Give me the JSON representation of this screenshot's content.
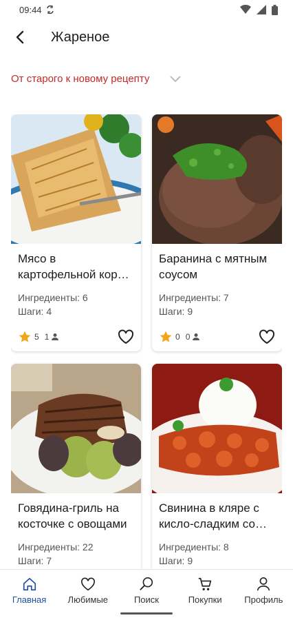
{
  "status": {
    "time": "09:44"
  },
  "header": {
    "title": "Жареное"
  },
  "sort": {
    "label": "От старого к новому рецепту"
  },
  "recipes": [
    {
      "name": "Мясо в картофельной кор…",
      "ingredients": "Ингредиенты: 6",
      "steps": "Шаги: 4",
      "rating": "5",
      "users": "1"
    },
    {
      "name": "Баранина с мятным соусом",
      "ingredients": "Ингредиенты: 7",
      "steps": "Шаги: 9",
      "rating": "0",
      "users": "0"
    },
    {
      "name": "Говядина-гриль на косточке с овощами",
      "ingredients": "Ингредиенты: 22",
      "steps": "Шаги: 7"
    },
    {
      "name": "Свинина в кляре с кисло-сладким со…",
      "ingredients": "Ингредиенты: 8",
      "steps": "Шаги: 9"
    }
  ],
  "nav": {
    "home": "Главная",
    "favorites": "Любимые",
    "search": "Поиск",
    "purchases": "Покупки",
    "profile": "Профиль"
  },
  "colors": {
    "accent": "#c62828",
    "nav_active": "#1e4fa3",
    "star": "#f2a516"
  }
}
